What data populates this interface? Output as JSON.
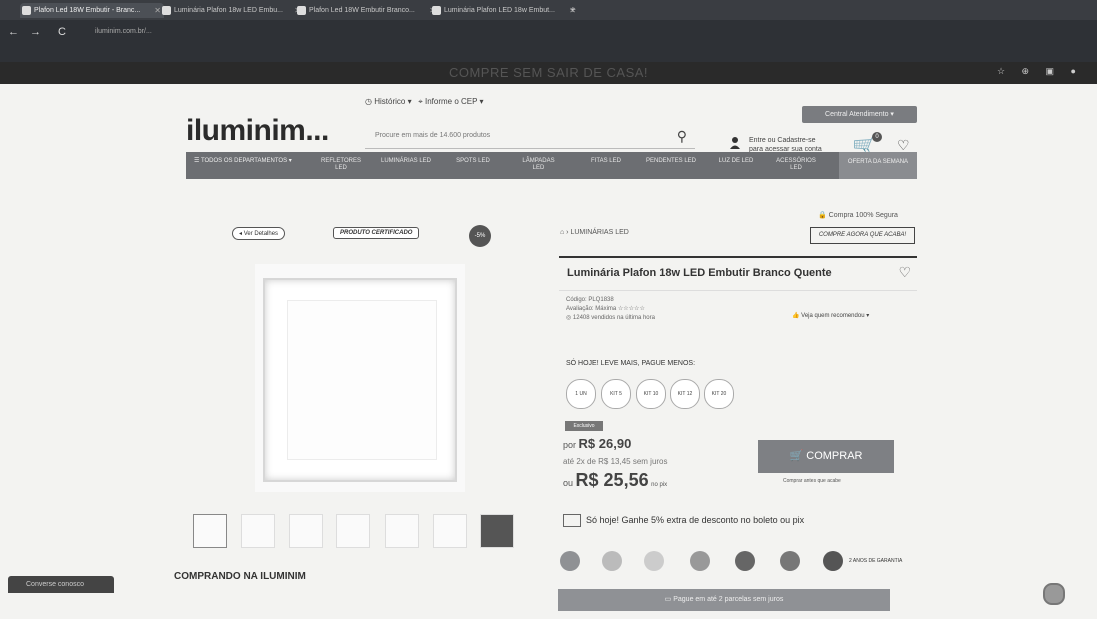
{
  "browser": {
    "tabs": [
      {
        "title": "Plafon Led 18W Embutir - Branc..."
      },
      {
        "title": "Luminária Plafon 18w LED Embu..."
      },
      {
        "title": "Plafon Led 18W Embutir Branco..."
      },
      {
        "title": "Luminária Plafon LED 18w Embut..."
      }
    ],
    "url": "iluminim.com.br/..."
  },
  "banner": {
    "text": "COMPRE SEM SAIR DE CASA!"
  },
  "header": {
    "historico": "Histórico",
    "informe_cep": "Informe o CEP",
    "logo": "iluminim...",
    "search_placeholder": "Procure em mais de 14.600 produtos",
    "login_line1": "Entre ou Cadastre-se",
    "login_line2": "para acessar sua conta",
    "central": "Central Atendimento",
    "cart_count": "0"
  },
  "nav": {
    "menu": "TODOS OS DEPARTAMENTOS",
    "items": [
      {
        "label": "REFLETORES LED"
      },
      {
        "label": "LUMINÁRIAS LED"
      },
      {
        "label": "SPOTS LED"
      },
      {
        "label": "LÂMPADAS LED"
      },
      {
        "label": "FITAS LED"
      },
      {
        "label": "PENDENTES LED"
      },
      {
        "label": "LUZ DE LED"
      },
      {
        "label": "ACESSÓRIOS LED"
      }
    ],
    "oferta": "OFERTA DA SEMANA"
  },
  "gallery": {
    "back": "Ver Detalhes",
    "certificado": "PRODUTO CERTIFICADO",
    "discount": "-5%"
  },
  "product": {
    "breadcrumb": "LUMINÁRIAS LED",
    "compra_segura": "Compra 100% Segura",
    "compre_agora": "COMPRE AGORA QUE ACABA!",
    "title": "Luminária Plafon 18w LED Embutir Branco Quente",
    "codigo": "Código: PLQ1838",
    "avaliacao": "Avaliação: Máxima",
    "vendidos": "12408 vendidos na última hora",
    "recomendou": "Veja quem recomendou",
    "sohoje": "SÓ HOJE! LEVE MAIS, PAGUE MENOS:",
    "kits": [
      "1 UN",
      "KIT 5",
      "KIT 10",
      "KIT 12",
      "KIT 20"
    ],
    "selo": "Exclusivo",
    "preco_label": "por",
    "preco": "R$ 26,90",
    "parcelas": "até 2x de R$ 13,45 sem juros",
    "pix_label": "ou",
    "pix_preco": "R$ 25,56",
    "pix_suffix": "no pix",
    "comprar": "COMPRAR",
    "comprar_sub": "Comprar antes que acabe",
    "boleto": "Só hoje! Ganhe 5% extra de desconto no boleto ou pix",
    "garantia": "2 ANOS DE GARANTIA",
    "parcel_bar": "Pague em até 2 parcelas sem juros"
  },
  "footer": {
    "comprando": "COMPRANDO NA ILUMINIM",
    "chat": "Converse conosco"
  }
}
